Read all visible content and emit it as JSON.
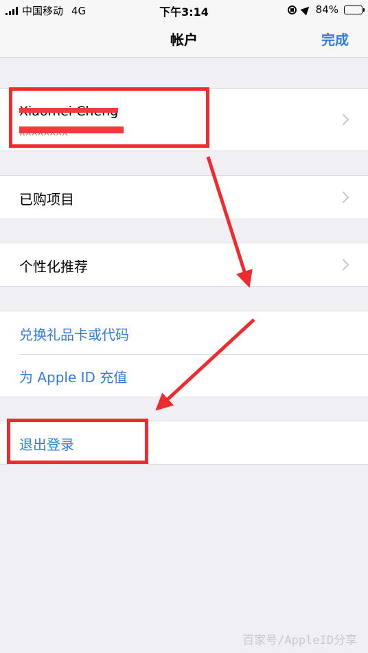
{
  "status": {
    "carrier": "中国移动",
    "network": "4G",
    "time": "下午3:14",
    "battery_pct": "84%",
    "battery_level": 0.84
  },
  "nav": {
    "title": "帐户",
    "done_label": "完成"
  },
  "account": {
    "name": "Xiaomei Cheng",
    "email": "xxxxxxxx"
  },
  "rows": {
    "purchased": "已购项目",
    "personalized": "个性化推荐",
    "redeem": "兑换礼品卡或代码",
    "add_funds": "为 Apple ID 充值",
    "sign_out": "退出登录"
  },
  "colors": {
    "link_blue": "#2f7cde",
    "annotation_red": "#ee2c30",
    "background": "#efeff4"
  },
  "watermark": "百家号/AppleID分享"
}
